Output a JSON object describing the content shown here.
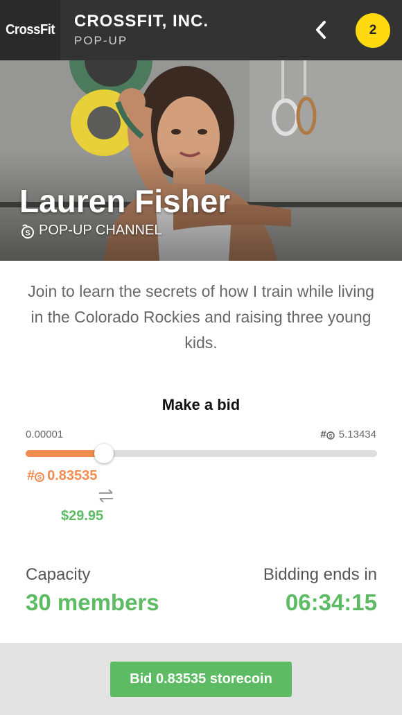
{
  "header": {
    "logo": "CrossFit",
    "title": "CROSSFIT, INC.",
    "subtitle": "POP-UP",
    "back_icon": "chevron-left-icon",
    "notification_count": "2"
  },
  "hero": {
    "name": "Lauren Fisher",
    "channel_label": "POP-UP CHANNEL",
    "channel_icon": "coin-icon"
  },
  "description": "Join to learn the secrets of how I train while living in the Colorado Rockies and raising three young kids.",
  "bid": {
    "title": "Make a bid",
    "min": "0.00001",
    "max_prefix": "#",
    "max": "5.13434",
    "slider_fraction": 0.2235,
    "coin_prefix": "#",
    "coin_value": "0.83535",
    "usd_value": "$29.95"
  },
  "stats": {
    "capacity_label": "Capacity",
    "capacity_value": "30 members",
    "ends_label": "Bidding ends in",
    "ends_value": "06:34:15"
  },
  "footer": {
    "button_label": "Bid 0.83535 storecoin"
  },
  "colors": {
    "header_bg": "#333333",
    "accent_orange": "#f28b4f",
    "accent_green": "#5dbb63",
    "badge_yellow": "#ffd90f"
  }
}
